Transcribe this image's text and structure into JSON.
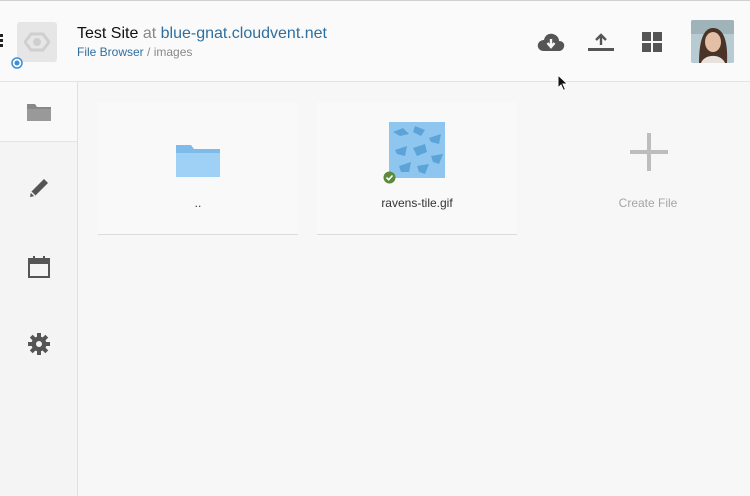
{
  "header": {
    "site_name": "Test Site",
    "at_text": "at",
    "host": "blue-gnat.cloudvent.net",
    "breadcrumb": {
      "root": "File Browser",
      "separator": "/",
      "current": "images"
    },
    "icons": [
      "download-icon",
      "upload-icon",
      "grid-view-icon"
    ]
  },
  "sidebar": {
    "items": [
      {
        "icon": "folder-icon",
        "active": true
      },
      {
        "icon": "pencil-icon",
        "active": false
      },
      {
        "icon": "calendar-icon",
        "active": false
      },
      {
        "icon": "gear-icon",
        "active": false
      }
    ]
  },
  "files": [
    {
      "name": "..",
      "type": "parent-folder"
    },
    {
      "name": "ravens-tile.gif",
      "type": "image",
      "status": "synced"
    }
  ],
  "create": {
    "label": "Create File"
  },
  "colors": {
    "link": "#2f6f9f",
    "folder": "#8ec6f0",
    "status_green": "#5a8a3a",
    "status_blue": "#3d8fd6",
    "icon_gray": "#555555"
  }
}
